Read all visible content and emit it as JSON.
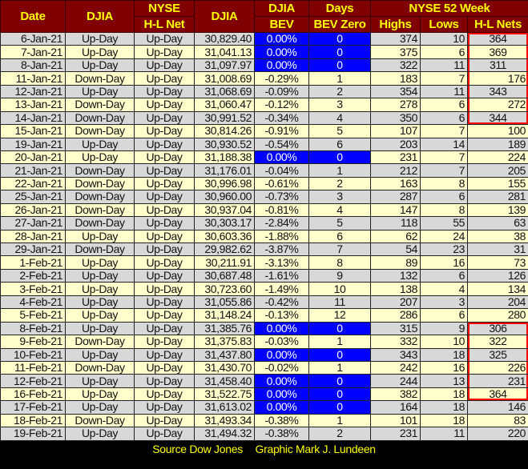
{
  "chart_data": {
    "type": "table",
    "headers": {
      "date": "Date",
      "djia_dir": "DJIA",
      "nyse_top": "NYSE",
      "nyse_bottom": "H-L Net",
      "djia_value": "DJIA",
      "bev_top": "DJIA",
      "bev_bottom": "BEV",
      "days_top": "Days",
      "days_bottom": "BEV Zero",
      "group": "NYSE 52 Week",
      "highs": "Highs",
      "lows": "Lows",
      "hl_nets": "H-L Nets"
    },
    "rows": [
      [
        "6-Jan-21",
        "Up-Day",
        "Up-Day",
        "30,829.40",
        "0.00%",
        "0",
        "374",
        "10",
        "364"
      ],
      [
        "7-Jan-21",
        "Up-Day",
        "Up-Day",
        "31,041.13",
        "0.00%",
        "0",
        "375",
        "6",
        "369"
      ],
      [
        "8-Jan-21",
        "Up-Day",
        "Up-Day",
        "31,097.97",
        "0.00%",
        "0",
        "322",
        "11",
        "311"
      ],
      [
        "11-Jan-21",
        "Down-Day",
        "Up-Day",
        "31,008.69",
        "-0.29%",
        "1",
        "183",
        "7",
        "176"
      ],
      [
        "12-Jan-21",
        "Up-Day",
        "Up-Day",
        "31,068.69",
        "-0.09%",
        "2",
        "354",
        "11",
        "343"
      ],
      [
        "13-Jan-21",
        "Down-Day",
        "Up-Day",
        "31,060.47",
        "-0.12%",
        "3",
        "278",
        "6",
        "272"
      ],
      [
        "14-Jan-21",
        "Down-Day",
        "Up-Day",
        "30,991.52",
        "-0.34%",
        "4",
        "350",
        "6",
        "344"
      ],
      [
        "15-Jan-21",
        "Down-Day",
        "Up-Day",
        "30,814.26",
        "-0.91%",
        "5",
        "107",
        "7",
        "100"
      ],
      [
        "19-Jan-21",
        "Up-Day",
        "Up-Day",
        "30,930.52",
        "-0.54%",
        "6",
        "203",
        "14",
        "189"
      ],
      [
        "20-Jan-21",
        "Up-Day",
        "Up-Day",
        "31,188.38",
        "0.00%",
        "0",
        "231",
        "7",
        "224"
      ],
      [
        "21-Jan-21",
        "Down-Day",
        "Up-Day",
        "31,176.01",
        "-0.04%",
        "1",
        "212",
        "7",
        "205"
      ],
      [
        "22-Jan-21",
        "Down-Day",
        "Up-Day",
        "30,996.98",
        "-0.61%",
        "2",
        "163",
        "8",
        "155"
      ],
      [
        "25-Jan-21",
        "Down-Day",
        "Up-Day",
        "30,960.00",
        "-0.73%",
        "3",
        "287",
        "6",
        "281"
      ],
      [
        "26-Jan-21",
        "Down-Day",
        "Up-Day",
        "30,937.04",
        "-0.81%",
        "4",
        "147",
        "8",
        "139"
      ],
      [
        "27-Jan-21",
        "Down-Day",
        "Up-Day",
        "30,303.17",
        "-2.84%",
        "5",
        "118",
        "55",
        "63"
      ],
      [
        "28-Jan-21",
        "Up-Day",
        "Up-Day",
        "30,603.36",
        "-1.88%",
        "6",
        "62",
        "24",
        "38"
      ],
      [
        "29-Jan-21",
        "Down-Day",
        "Up-Day",
        "29,982.62",
        "-3.87%",
        "7",
        "54",
        "23",
        "31"
      ],
      [
        "1-Feb-21",
        "Up-Day",
        "Up-Day",
        "30,211.91",
        "-3.13%",
        "8",
        "89",
        "16",
        "73"
      ],
      [
        "2-Feb-21",
        "Up-Day",
        "Up-Day",
        "30,687.48",
        "-1.61%",
        "9",
        "132",
        "6",
        "126"
      ],
      [
        "3-Feb-21",
        "Up-Day",
        "Up-Day",
        "30,723.60",
        "-1.49%",
        "10",
        "138",
        "4",
        "134"
      ],
      [
        "4-Feb-21",
        "Up-Day",
        "Up-Day",
        "31,055.86",
        "-0.42%",
        "11",
        "207",
        "3",
        "204"
      ],
      [
        "5-Feb-21",
        "Up-Day",
        "Up-Day",
        "31,148.24",
        "-0.13%",
        "12",
        "286",
        "6",
        "280"
      ],
      [
        "8-Feb-21",
        "Up-Day",
        "Up-Day",
        "31,385.76",
        "0.00%",
        "0",
        "315",
        "9",
        "306"
      ],
      [
        "9-Feb-21",
        "Down-Day",
        "Up-Day",
        "31,375.83",
        "-0.03%",
        "1",
        "332",
        "10",
        "322"
      ],
      [
        "10-Feb-21",
        "Up-Day",
        "Up-Day",
        "31,437.80",
        "0.00%",
        "0",
        "343",
        "18",
        "325"
      ],
      [
        "11-Feb-21",
        "Down-Day",
        "Up-Day",
        "31,430.70",
        "-0.02%",
        "1",
        "242",
        "16",
        "226"
      ],
      [
        "12-Feb-21",
        "Up-Day",
        "Up-Day",
        "31,458.40",
        "0.00%",
        "0",
        "244",
        "13",
        "231"
      ],
      [
        "16-Feb-21",
        "Up-Day",
        "Up-Day",
        "31,522.75",
        "0.00%",
        "0",
        "382",
        "18",
        "364"
      ],
      [
        "17-Feb-21",
        "Up-Day",
        "Up-Day",
        "31,613.02",
        "0.00%",
        "0",
        "164",
        "18",
        "146"
      ],
      [
        "18-Feb-21",
        "Down-Day",
        "Up-Day",
        "31,493.34",
        "-0.38%",
        "1",
        "101",
        "18",
        "83"
      ],
      [
        "19-Feb-21",
        "Up-Day",
        "Up-Day",
        "31,494.32",
        "-0.38%",
        "2",
        "231",
        "11",
        "220"
      ]
    ],
    "highlighted_hl_ranges": [
      [
        0,
        6
      ],
      [
        22,
        27
      ]
    ]
  },
  "colors": {
    "header_bg": "#800000",
    "header_text": "#ffff00",
    "bev_zero": "#0000ff",
    "highlight_box": "#ff0000"
  },
  "footer": {
    "source": "Source Dow Jones",
    "credit": "Graphic Mark J. Lundeen"
  }
}
